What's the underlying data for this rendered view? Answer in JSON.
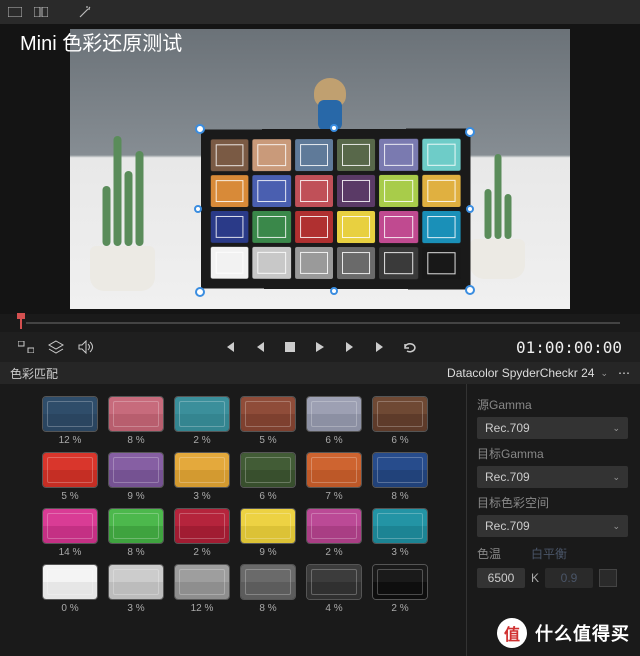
{
  "overlay_title": "Mini 色彩还原测试",
  "timecode": "01:00:00:00",
  "panel_title": "色彩匹配",
  "preset_name": "Datacolor SpyderCheckr 24",
  "sidebar": {
    "source_gamma_label": "源Gamma",
    "source_gamma_value": "Rec.709",
    "target_gamma_label": "目标Gamma",
    "target_gamma_value": "Rec.709",
    "target_cs_label": "目标色彩空间",
    "target_cs_value": "Rec.709",
    "temp_label": "色温",
    "temp_label2": "白平衡",
    "temp_value": "6500",
    "temp_unit": "K",
    "tint_value": "0.9"
  },
  "watermark": {
    "badge": "值",
    "text": "什么值得买"
  },
  "checker_colors": [
    [
      "#7a5a44",
      "#c99a7a",
      "#5f7a99",
      "#58684a",
      "#7a7ab0",
      "#6eccc8"
    ],
    [
      "#d88a38",
      "#4a5fb0",
      "#c05058",
      "#5a3a66",
      "#a8cc4a",
      "#e0b040"
    ],
    [
      "#2a3a88",
      "#3a884a",
      "#b03030",
      "#e8d040",
      "#c04a90",
      "#1a90b8"
    ],
    [
      "#f2f2f2",
      "#c8c8c8",
      "#9a9a9a",
      "#6a6a6a",
      "#3a3a3a",
      "#181818"
    ]
  ],
  "swatches": [
    {
      "top": "#2f4d6a",
      "bot": "#2a4560",
      "pct": "12 %"
    },
    {
      "top": "#c76b7c",
      "bot": "#b85e6e",
      "pct": "8 %"
    },
    {
      "top": "#3b8f9b",
      "bot": "#348590",
      "pct": "2 %"
    },
    {
      "top": "#8f4c39",
      "bot": "#7e402f",
      "pct": "5 %"
    },
    {
      "top": "#9da0b3",
      "bot": "#8c90a3",
      "pct": "6 %"
    },
    {
      "top": "#6f4934",
      "bot": "#5e3b2a",
      "pct": "6 %"
    },
    {
      "top": "#d9362c",
      "bot": "#c52e24",
      "pct": "5 %"
    },
    {
      "top": "#865fa3",
      "bot": "#755292",
      "pct": "9 %"
    },
    {
      "top": "#e4a93c",
      "bot": "#d39a30",
      "pct": "3 %"
    },
    {
      "top": "#425c36",
      "bot": "#384f2d",
      "pct": "6 %"
    },
    {
      "top": "#ce6430",
      "bot": "#bd5828",
      "pct": "7 %"
    },
    {
      "top": "#274c8c",
      "bot": "#21427a",
      "pct": "8 %"
    },
    {
      "top": "#d93c95",
      "bot": "#c43084",
      "pct": "14 %"
    },
    {
      "top": "#4cb84c",
      "bot": "#3fa33f",
      "pct": "8 %"
    },
    {
      "top": "#b5243c",
      "bot": "#a11c32",
      "pct": "2 %"
    },
    {
      "top": "#edd243",
      "bot": "#dcc236",
      "pct": "9 %"
    },
    {
      "top": "#bb4a96",
      "bot": "#a93e84",
      "pct": "2 %"
    },
    {
      "top": "#2394a5",
      "bot": "#1c8494",
      "pct": "3 %"
    },
    {
      "top": "#f4f4f4",
      "bot": "#e6e6e6",
      "pct": "0 %"
    },
    {
      "top": "#cccccc",
      "bot": "#bcbcbc",
      "pct": "3 %"
    },
    {
      "top": "#9e9e9e",
      "bot": "#8e8e8e",
      "pct": "12 %"
    },
    {
      "top": "#6a6a6a",
      "bot": "#5c5c5c",
      "pct": "8 %"
    },
    {
      "top": "#3c3c3c",
      "bot": "#303030",
      "pct": "4 %"
    },
    {
      "top": "#1a1a1a",
      "bot": "#0e0e0e",
      "pct": "2 %"
    }
  ]
}
